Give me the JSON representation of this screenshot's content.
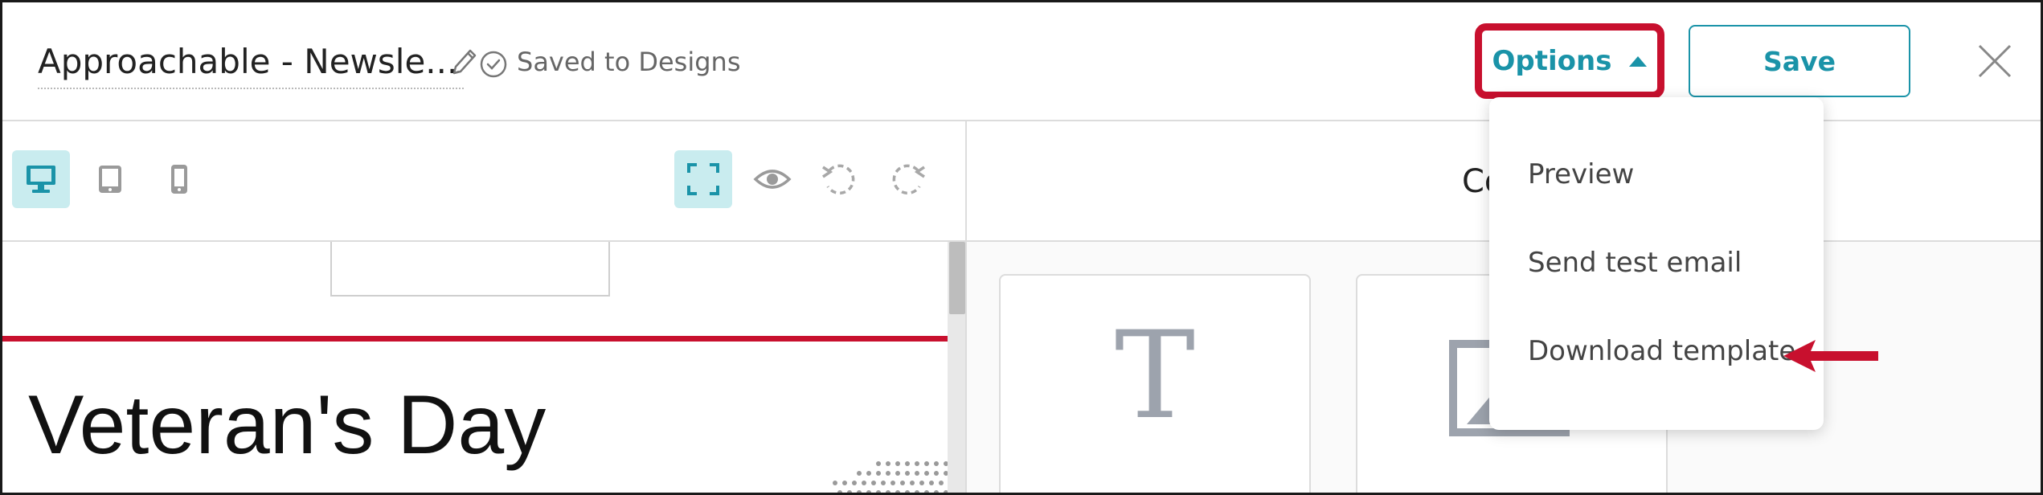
{
  "header": {
    "design_title": "Approachable - Newsle...",
    "saved_status": "Saved to Designs",
    "options_label": "Options",
    "save_label": "Save"
  },
  "toolbar": {
    "devices": [
      {
        "name": "desktop",
        "icon": "desktop-icon",
        "active": true
      },
      {
        "name": "tablet",
        "icon": "tablet-icon",
        "active": false
      },
      {
        "name": "mobile",
        "icon": "mobile-icon",
        "active": false
      }
    ],
    "actions": [
      "fullscreen-icon",
      "eye-icon",
      "undo-icon",
      "redo-icon"
    ]
  },
  "right_panel": {
    "header_text": "Co",
    "content_cards": [
      {
        "icon": "text-block-icon",
        "glyph": "T"
      },
      {
        "icon": "image-block-icon"
      }
    ]
  },
  "canvas": {
    "headline": "Veteran's Day"
  },
  "options_menu": {
    "items": [
      "Preview",
      "Send test email",
      "Download template"
    ],
    "highlighted_item": "Download template"
  },
  "colors": {
    "accent": "#1a93a8",
    "highlight": "#c8102e",
    "active_tool_bg": "#c9ecef"
  }
}
